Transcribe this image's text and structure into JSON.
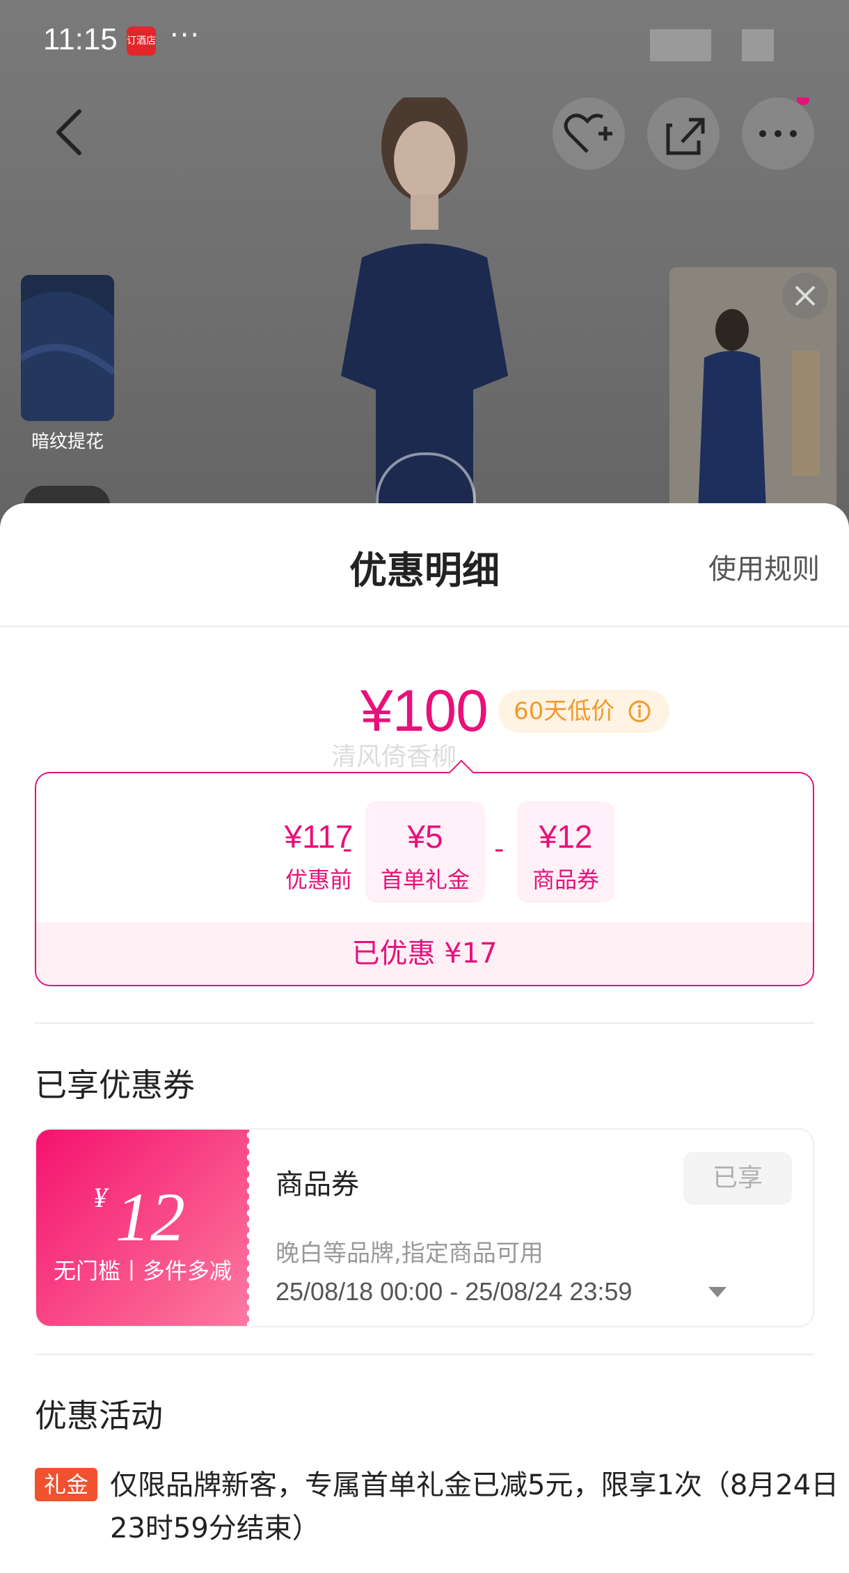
{
  "status_bar": {
    "time": "11:15",
    "app_badge": "订酒店",
    "dots": "···"
  },
  "background": {
    "thumb_left_label": "暗纹提花"
  },
  "sheet": {
    "title": "优惠明细",
    "rules_link": "使用规则",
    "price": "¥100",
    "low_price_badge": "60天低价",
    "watermark": "清风倚香柳",
    "breakdown": {
      "items": [
        {
          "amount": "¥117",
          "label": "优惠前"
        },
        {
          "amount": "¥5",
          "label": "首单礼金"
        },
        {
          "amount": "¥12",
          "label": "商品券"
        }
      ],
      "op": "-",
      "total": "已优惠 ¥17"
    },
    "coupons_section": {
      "title": "已享优惠券"
    },
    "coupon": {
      "yen": "¥",
      "amount": "12",
      "condition": "无门槛丨多件多减",
      "name": "商品券",
      "button": "已享",
      "scope": "晚白等品牌,指定商品可用",
      "date": "25/08/18 00:00 - 25/08/24 23:59"
    },
    "activity_section": {
      "title": "优惠活动",
      "tag": "礼金",
      "text": "仅限品牌新客，专属首单礼金已减5元，限享1次（8月24日23时59分结束）"
    }
  },
  "colors": {
    "accent": "#e8107a",
    "badge_orange": "#f19a2a",
    "tag_red": "#f0512f"
  }
}
